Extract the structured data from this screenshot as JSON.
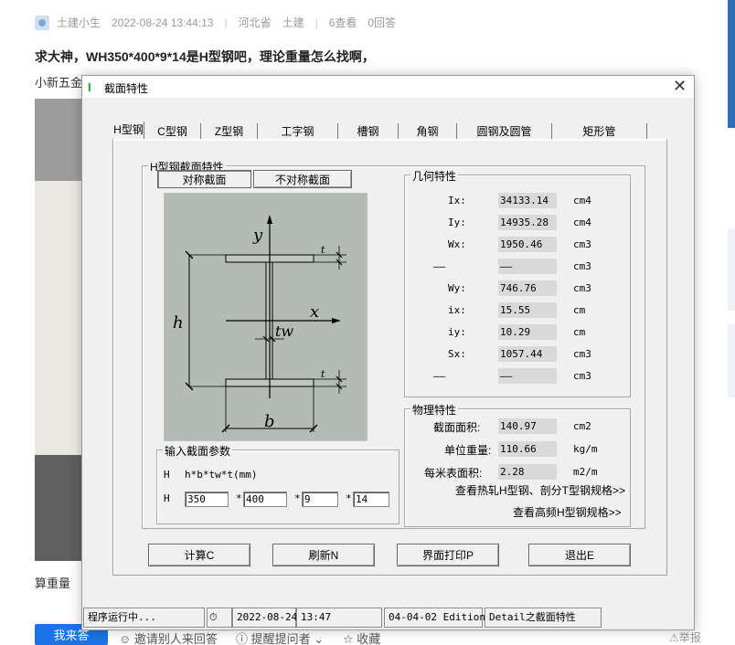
{
  "web": {
    "author": "土建小生",
    "datetime": "2022-08-24 13:44:13",
    "location": "河北省",
    "category": "土建",
    "views": "6查看",
    "answers": "0回答",
    "question": "求大神，WH350*400*9*14是H型钢吧，理论重量怎么找啊，",
    "answer_prefix": "小新五金",
    "calc_weight": "算重量",
    "answer_button": "我来答",
    "invite": "邀请别人来回答",
    "remind": "提醒提问者",
    "favorite": "收藏",
    "report": "举报"
  },
  "window": {
    "title": "截面特性",
    "tabs": [
      "H型钢",
      "C型钢",
      "Z型钢",
      "工字钢",
      "槽钢",
      "角钢",
      "圆钢及圆管",
      "矩形管"
    ],
    "active_tab": "H型钢",
    "section_group": "H型钢截面特性",
    "sym_button": "对称截面",
    "asym_button": "不对称截面",
    "diagram_labels": {
      "y": "y",
      "x": "x",
      "h": "h",
      "tw": "tw",
      "b": "b",
      "t1": "t",
      "t2": "t"
    },
    "geometry": {
      "title": "几何特性",
      "rows": [
        {
          "label": "Ix:",
          "value": "34133.14",
          "unit": "cm4"
        },
        {
          "label": "Iy:",
          "value": "14935.28",
          "unit": "cm4"
        },
        {
          "label": "Wx:",
          "value": "1950.46",
          "unit": "cm3"
        },
        {
          "label": "——",
          "value": "——",
          "unit": "cm3"
        },
        {
          "label": "Wy:",
          "value": "746.76",
          "unit": "cm3"
        },
        {
          "label": "ix:",
          "value": "15.55",
          "unit": "cm"
        },
        {
          "label": "iy:",
          "value": "10.29",
          "unit": "cm"
        },
        {
          "label": "Sx:",
          "value": "1057.44",
          "unit": "cm3"
        },
        {
          "label": "——",
          "value": "——",
          "unit": "cm3"
        }
      ]
    },
    "physical": {
      "title": "物理特性",
      "rows": [
        {
          "label": "截面面积:",
          "value": "140.97",
          "unit": "cm2"
        },
        {
          "label": "单位重量:",
          "value": "110.66",
          "unit": "kg/m"
        },
        {
          "label": "每米表面积:",
          "value": "2.28",
          "unit": "m2/m"
        }
      ],
      "link1": "查看热轧H型钢、剖分T型钢规格>>",
      "link2": "查看高频H型钢规格>>"
    },
    "input": {
      "title": "输入截面参数",
      "hint_prefix": "H",
      "hint": "h*b*tw*t(mm)",
      "row_prefix": "H",
      "h": "350",
      "b": "400",
      "tw": "9",
      "t": "14",
      "star": "*"
    },
    "buttons": {
      "calc": "计算C",
      "refresh": "刷新N",
      "print": "界面打印P",
      "exit": "退出E"
    },
    "status": {
      "state": "程序运行中...",
      "date": "2022-08-24",
      "time": "13:47",
      "edition": "04-04-02 Edition",
      "info": "Detail之截面特性"
    }
  }
}
